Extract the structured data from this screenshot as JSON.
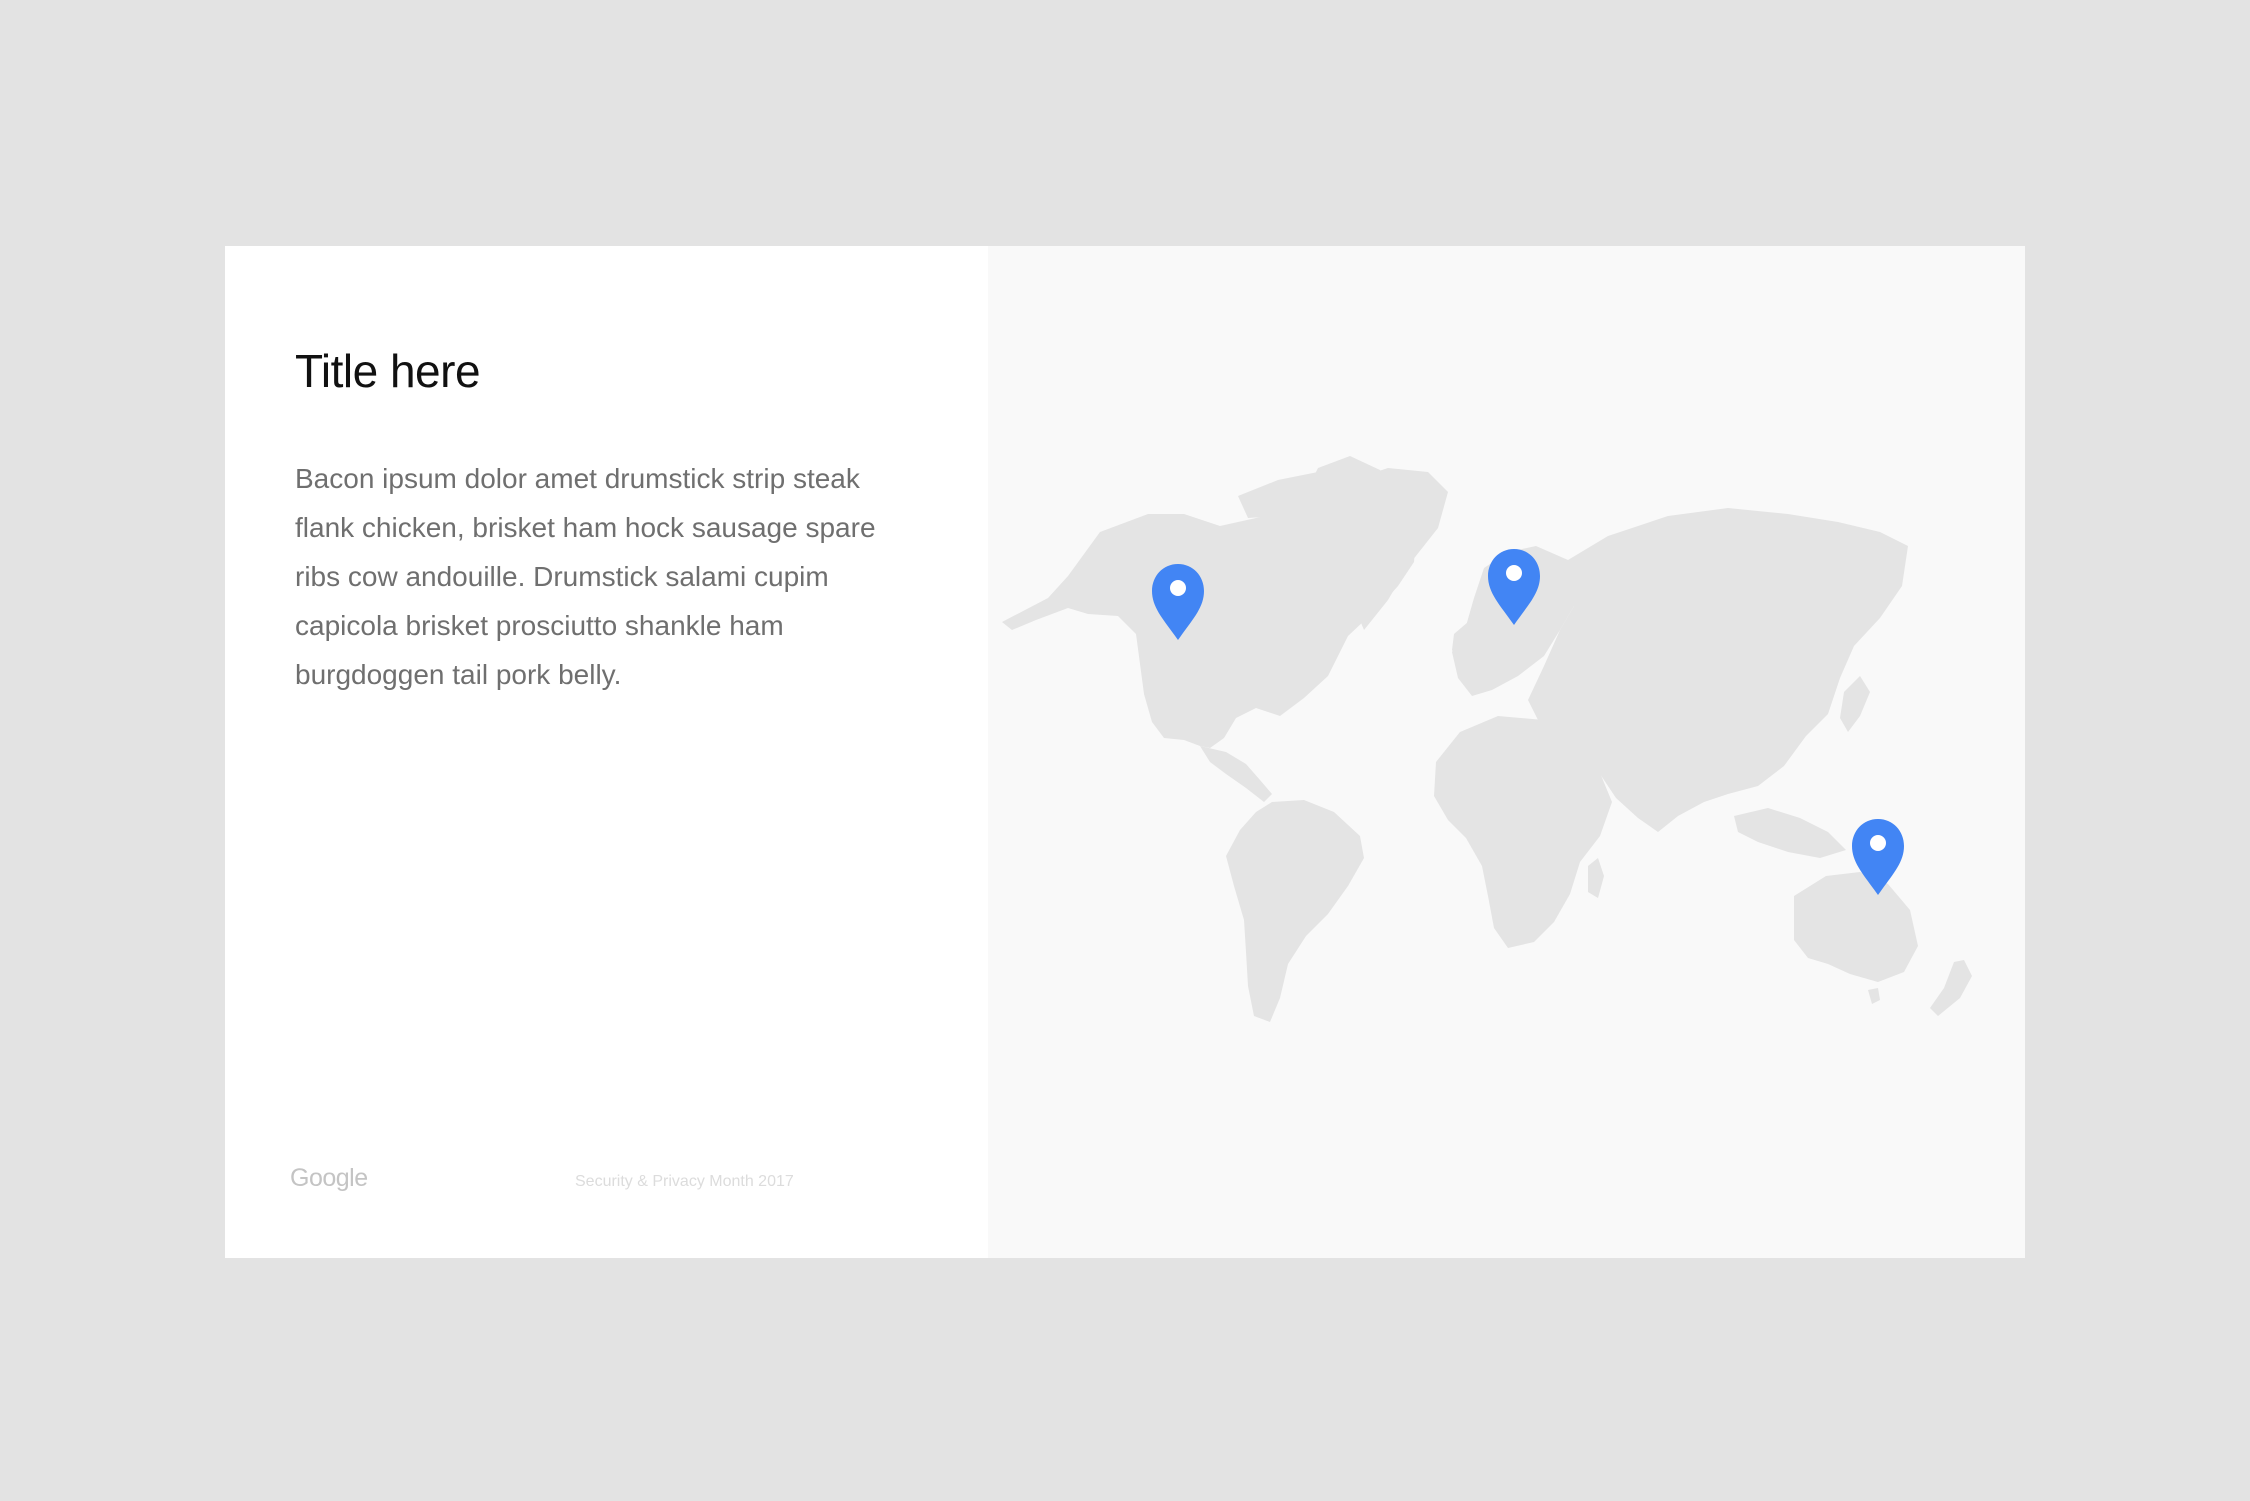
{
  "slide": {
    "title": "Title here",
    "body": "Bacon ipsum dolor amet drumstick strip steak flank chicken, brisket ham hock sausage spare ribs cow andouille. Drumstick salami cupim capicola brisket prosciutto shankle ham burgdoggen tail pork belly.",
    "logo_text": "Google",
    "footer": "Security & Privacy Month 2017"
  },
  "map": {
    "land_color": "#e4e4e4",
    "background_color": "#f9f9f9",
    "pin_color": "#4285f4",
    "pins": [
      {
        "name": "map-pin-north-america",
        "icon": "map-pin-icon"
      },
      {
        "name": "map-pin-europe",
        "icon": "map-pin-icon"
      },
      {
        "name": "map-pin-australia",
        "icon": "map-pin-icon"
      }
    ]
  }
}
